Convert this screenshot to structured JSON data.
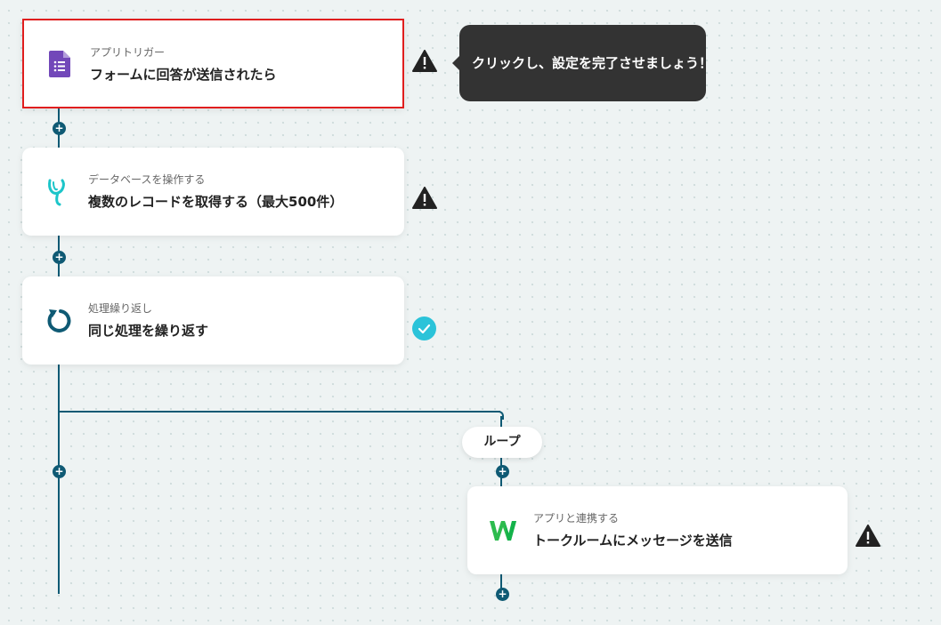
{
  "flow": {
    "steps": [
      {
        "subtitle": "アプリトリガー",
        "title": "フォームに回答が送信されたら",
        "icon": "google-forms-icon",
        "status": "warning"
      },
      {
        "subtitle": "データベースを操作する",
        "title": "複数のレコードを取得する（最大500件）",
        "icon": "database-app-icon",
        "status": "warning"
      },
      {
        "subtitle": "処理繰り返し",
        "title": "同じ処理を繰り返す",
        "icon": "loop-icon",
        "status": "complete"
      },
      {
        "subtitle": "アプリと連携する",
        "title": "トークルームにメッセージを送信",
        "icon": "lineworks-icon",
        "status": "warning"
      }
    ],
    "tooltip": "クリックし、設定を完了させましょう！",
    "loop_label": "ループ",
    "add_symbol": "+"
  },
  "colors": {
    "line": "#0f5a74",
    "selected_border": "#e01e1e",
    "check": "#2bc3d9",
    "tooltip_bg": "#333333",
    "forms_purple": "#7248b9"
  }
}
